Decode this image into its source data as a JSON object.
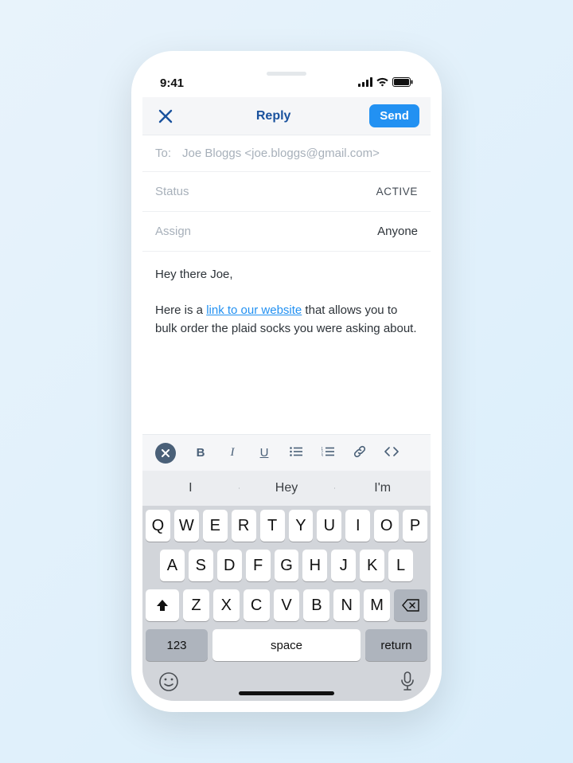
{
  "status_bar": {
    "time": "9:41"
  },
  "nav": {
    "title": "Reply",
    "send_label": "Send"
  },
  "to": {
    "label": "To:",
    "value": "Joe Bloggs <joe.bloggs@gmail.com>"
  },
  "status_row": {
    "label": "Status",
    "value": "ACTIVE"
  },
  "assign_row": {
    "label": "Assign",
    "value": "Anyone"
  },
  "message": {
    "greeting": "Hey there Joe,",
    "pre_link": "Here is a ",
    "link_text": "link to our website",
    "post_link": " that allows you to bulk order the plaid socks you were asking about."
  },
  "toolbar": {
    "bold": "B",
    "italic": "I",
    "underline": "U"
  },
  "keyboard": {
    "predictions": [
      "I",
      "Hey",
      "I'm"
    ],
    "row1": [
      "Q",
      "W",
      "E",
      "R",
      "T",
      "Y",
      "U",
      "I",
      "O",
      "P"
    ],
    "row2": [
      "A",
      "S",
      "D",
      "F",
      "G",
      "H",
      "J",
      "K",
      "L"
    ],
    "row3": [
      "Z",
      "X",
      "C",
      "V",
      "B",
      "N",
      "M"
    ],
    "mode_key": "123",
    "space_label": "space",
    "return_label": "return"
  }
}
